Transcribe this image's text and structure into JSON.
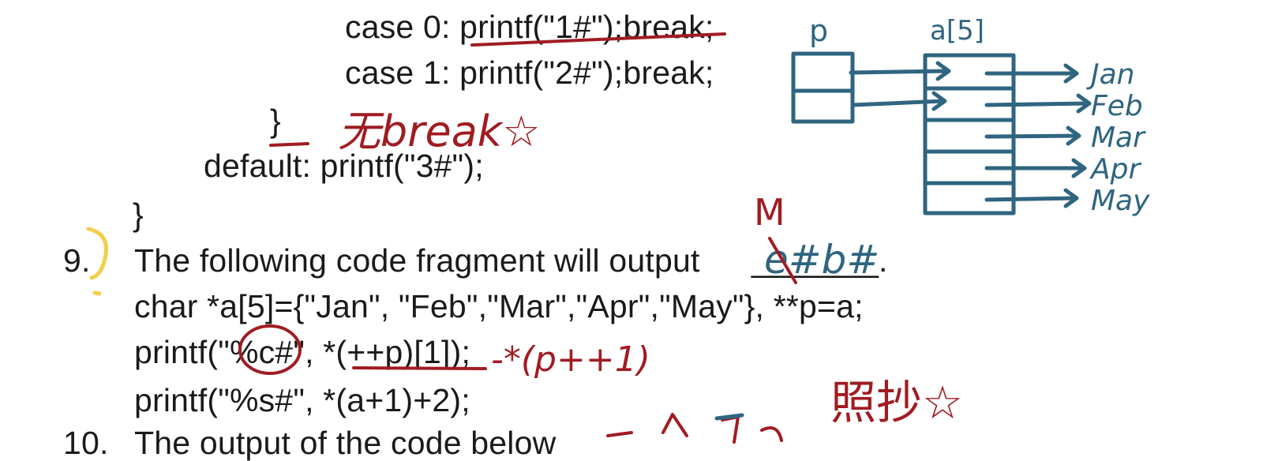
{
  "code_top": {
    "case0": "case 0: printf(\"1#\");break;",
    "case1": "case 1: printf(\"2#\");break;",
    "inner_brace": "}",
    "default_line": "default: printf(\"3#\");",
    "outer_brace": "}"
  },
  "question9": {
    "number": "9.",
    "text": "The following code fragment will output",
    "blank": "_______.",
    "code_line1": "char *a[5]={\"Jan\", \"Feb\",\"Mar\",\"Apr\",\"May\"}, **p=a;",
    "code_line2": "printf(\"%c#\", *(++p)[1]);",
    "code_line3": "printf(\"%s#\", *(a+1)+2);"
  },
  "question10": {
    "number": "10.",
    "text": "The output of the code below"
  },
  "handwriting": {
    "no_break_note": "无break☆",
    "answer": "e#b#",
    "correction": "M",
    "expr_note": "-*(p++1)",
    "copy_note": "照抄☆",
    "diagram_p_label": "p",
    "diagram_a_label": "a[5]",
    "diagram_months": [
      "Jan",
      "Feb",
      "Mar",
      "Apr",
      "May"
    ]
  },
  "colors": {
    "text": "#1a1a1a",
    "red_ink": "#a01c22",
    "blue_ink": "#2f6580",
    "yellow_ink": "#f2cf4a"
  }
}
